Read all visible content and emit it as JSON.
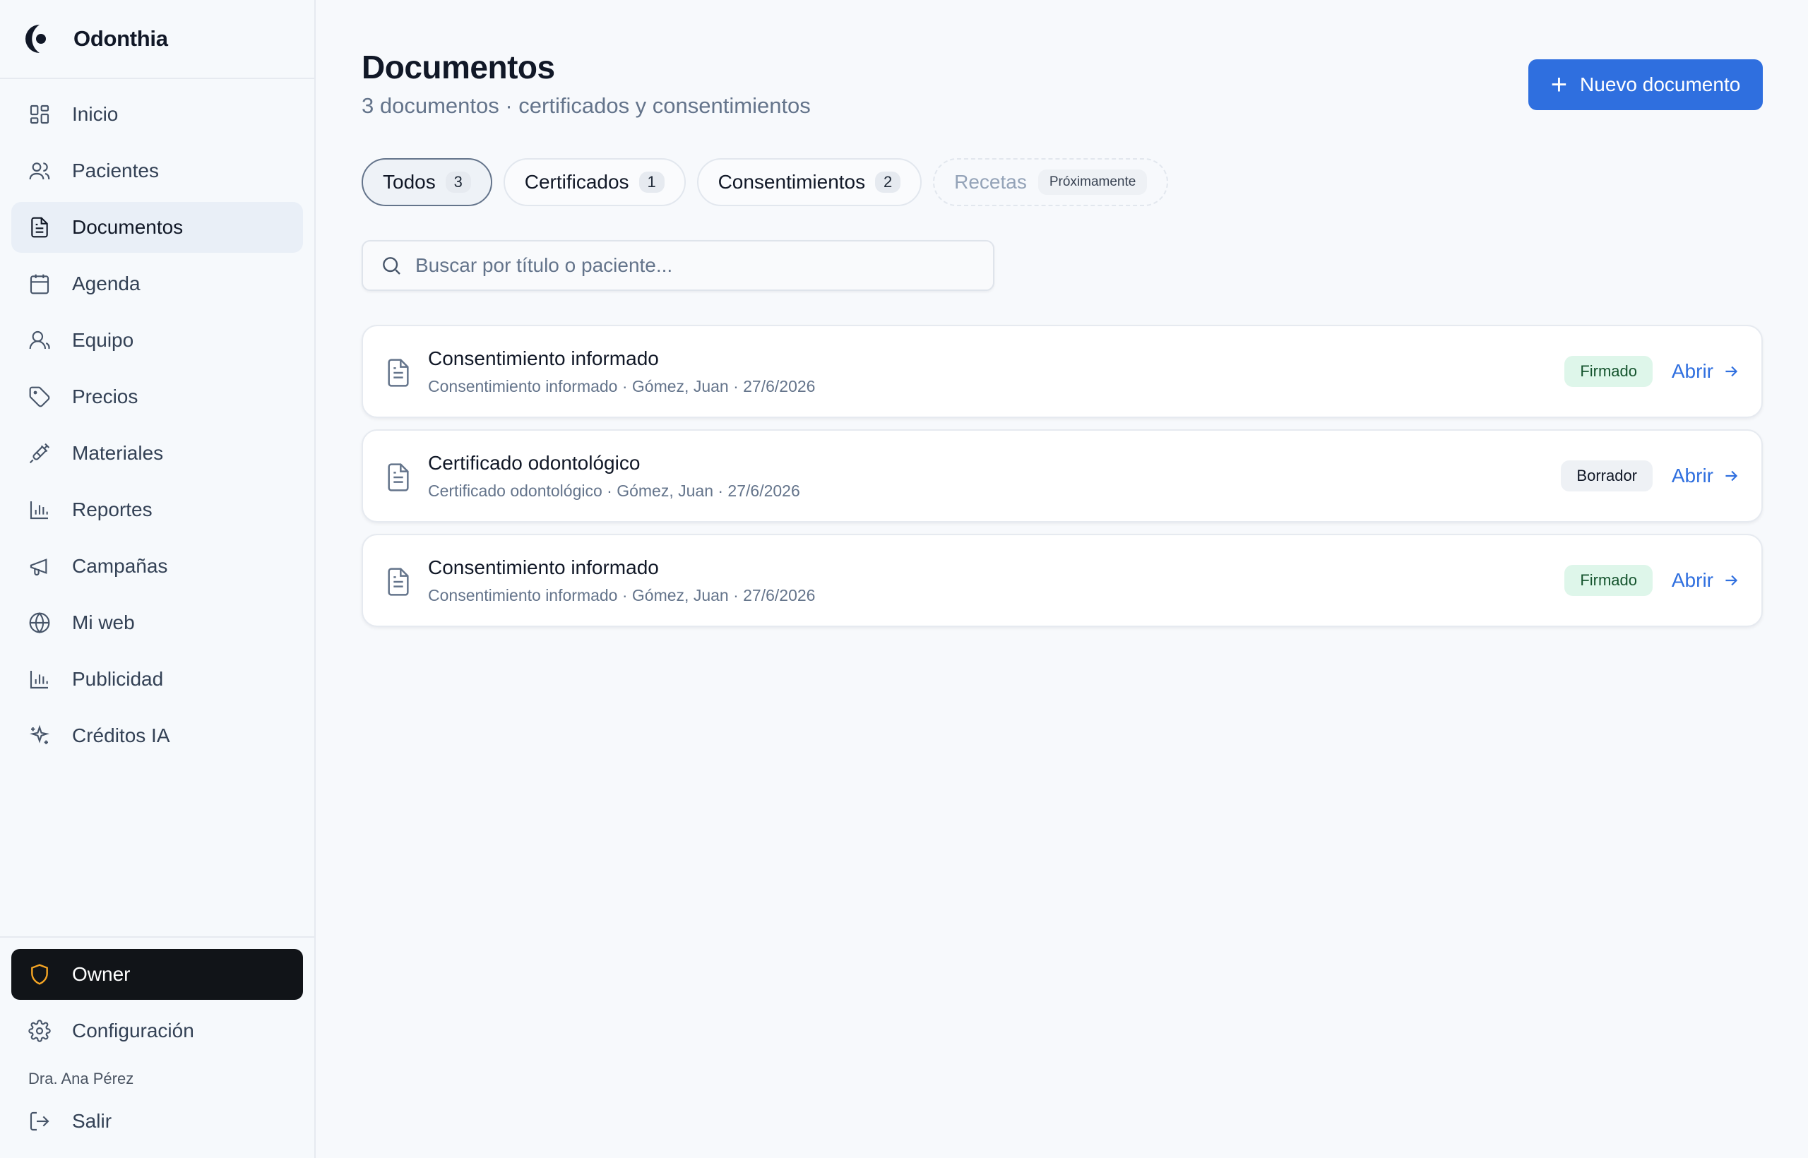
{
  "brand": {
    "name": "Odonthia",
    "logo_icon": "crescent-logo-icon"
  },
  "sidebar": {
    "items": [
      {
        "label": "Inicio",
        "icon": "dashboard-grid-icon"
      },
      {
        "label": "Pacientes",
        "icon": "users-icon"
      },
      {
        "label": "Documentos",
        "icon": "file-text-icon",
        "active": true
      },
      {
        "label": "Agenda",
        "icon": "calendar-icon"
      },
      {
        "label": "Equipo",
        "icon": "user-group-icon"
      },
      {
        "label": "Precios",
        "icon": "tag-icon"
      },
      {
        "label": "Materiales",
        "icon": "syringe-icon"
      },
      {
        "label": "Reportes",
        "icon": "bar-chart-icon"
      },
      {
        "label": "Campañas",
        "icon": "megaphone-icon"
      },
      {
        "label": "Mi web",
        "icon": "globe-icon"
      },
      {
        "label": "Publicidad",
        "icon": "bar-chart-icon"
      },
      {
        "label": "Créditos IA",
        "icon": "sparkles-icon"
      }
    ],
    "role": {
      "label": "Owner",
      "icon": "shield-icon",
      "icon_color": "#f5a524"
    },
    "settings": {
      "label": "Configuración",
      "icon": "gear-icon"
    },
    "user_name": "Dra. Ana Pérez",
    "logout": {
      "label": "Salir",
      "icon": "logout-icon"
    }
  },
  "header": {
    "title": "Documentos",
    "subtitle": "3 documentos · certificados y consentimientos",
    "new_button": "Nuevo documento"
  },
  "tabs": [
    {
      "label": "Todos",
      "count": "3",
      "active": true
    },
    {
      "label": "Certificados",
      "count": "1"
    },
    {
      "label": "Consentimientos",
      "count": "2"
    },
    {
      "label": "Recetas",
      "badge": "Próximamente",
      "disabled": true
    }
  ],
  "search": {
    "placeholder": "Buscar por título o paciente...",
    "value": ""
  },
  "documents": [
    {
      "title": "Consentimiento informado",
      "meta": "Consentimiento informado · Gómez, Juan · 27/6/2026",
      "status": "Firmado",
      "status_type": "signed",
      "action": "Abrir"
    },
    {
      "title": "Certificado odontológico",
      "meta": "Certificado odontológico · Gómez, Juan · 27/6/2026",
      "status": "Borrador",
      "status_type": "draft",
      "action": "Abrir"
    },
    {
      "title": "Consentimiento informado",
      "meta": "Consentimiento informado · Gómez, Juan · 27/6/2026",
      "status": "Firmado",
      "status_type": "signed",
      "action": "Abrir"
    }
  ],
  "colors": {
    "accent": "#2f6fdf",
    "signed_bg": "#def6ea",
    "draft_bg": "#eef1f5",
    "sidebar_active_bg": "#e9eff7"
  }
}
